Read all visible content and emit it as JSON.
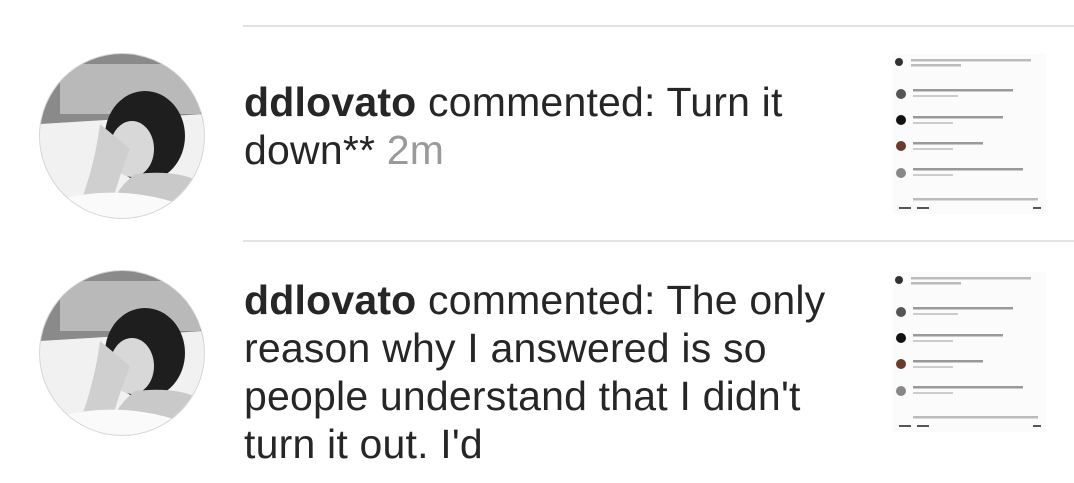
{
  "notifications": [
    {
      "username": "ddlovato",
      "action": " commented: ",
      "comment": "Turn it down**",
      "time": "2m",
      "avatar_icon": "profile-photo",
      "thumbnail_icon": "post-thumbnail"
    },
    {
      "username": "ddlovato",
      "action": " commented: ",
      "comment": "The only reason why I answered is so people understand that I didn't turn it out. I'd",
      "avatar_icon": "profile-photo",
      "thumbnail_icon": "post-thumbnail"
    }
  ],
  "colors": {
    "text": "#262626",
    "timestamp": "#9a9a9a",
    "divider": "#e3e3e3",
    "background": "#ffffff"
  }
}
